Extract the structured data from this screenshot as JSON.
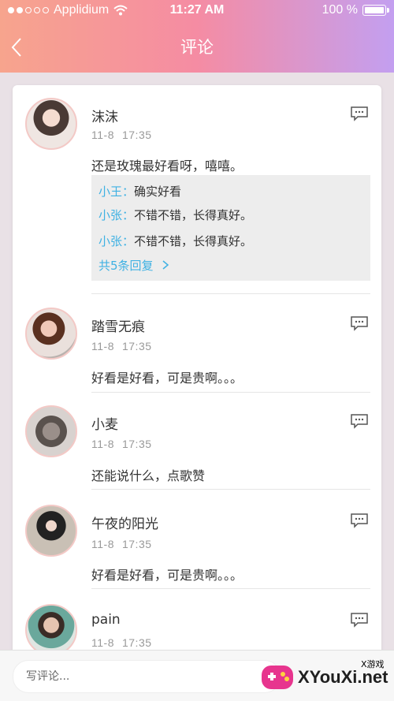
{
  "status": {
    "carrier": "Applidium",
    "time": "11:27 AM",
    "battery": "100 %",
    "battery_level": 1.0
  },
  "nav": {
    "title": "评论"
  },
  "comments": [
    {
      "username": "沫沫",
      "date": "11-8",
      "time": "17:35",
      "text": "还是玫瑰最好看呀，嘻嘻。",
      "replies": [
        {
          "name": "小王：",
          "text": "确实好看"
        },
        {
          "name": "小张：",
          "text": "不错不错，长得真好。"
        },
        {
          "name": "小张：",
          "text": "不错不错，长得真好。"
        }
      ],
      "more_label": "共5条回复"
    },
    {
      "username": "踏雪无痕",
      "date": "11-8",
      "time": "17:35",
      "text": "好看是好看，可是贵啊。。。"
    },
    {
      "username": "小麦",
      "date": "11-8",
      "time": "17:35",
      "text": "还能说什么，点歌赞"
    },
    {
      "username": "午夜的阳光",
      "date": "11-8",
      "time": "17:35",
      "text": "好看是好看，可是贵啊。。。"
    },
    {
      "username": "pain",
      "date": "11-8",
      "time": "17:35",
      "text": ""
    }
  ],
  "bottom": {
    "placeholder": "写评论..."
  },
  "watermark": {
    "text": "XYouXi.net",
    "badge": "X游戏"
  },
  "colors": {
    "accent": "#3fb1e3",
    "header_start": "#f7a48d",
    "header_end": "#c39ff0"
  }
}
